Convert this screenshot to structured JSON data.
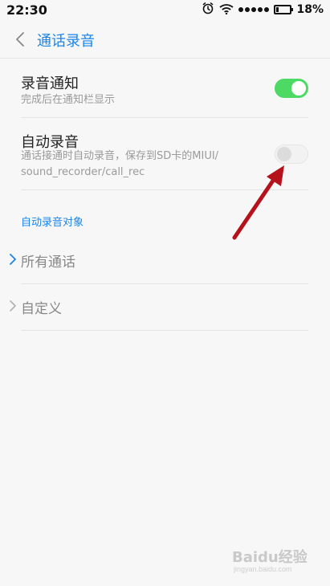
{
  "status_bar": {
    "time": "22:30",
    "battery_percent": "18%",
    "battery_level": 0.18
  },
  "header": {
    "title": "通话录音"
  },
  "settings": [
    {
      "title": "录音通知",
      "subtitle": "完成后在通知栏显示",
      "enabled": true
    },
    {
      "title": "自动录音",
      "subtitle_line1": "通话接通时自动录音，保存到SD卡的MIUI/",
      "subtitle_line2": "sound_recorder/call_rec",
      "enabled": false
    }
  ],
  "auto_record_target": {
    "section_title": "自动录音对象",
    "options": [
      {
        "label": "所有通话",
        "selected": true
      },
      {
        "label": "自定义",
        "selected": false
      }
    ]
  },
  "watermark": {
    "text": "Baidu经验",
    "url": "jingyan.baidu.com"
  },
  "colors": {
    "accent": "#1a85e8",
    "toggle_on": "#4cd964",
    "annotation_arrow": "#b5121b"
  }
}
